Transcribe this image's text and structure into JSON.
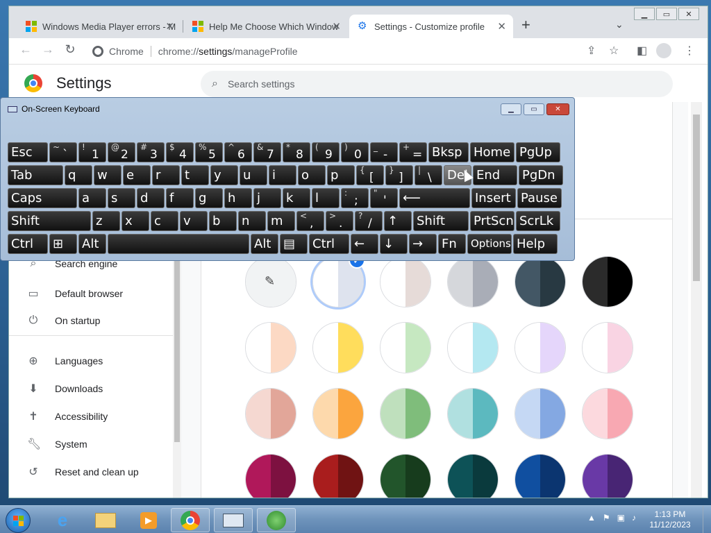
{
  "browser": {
    "tabs": [
      {
        "title": "Windows Media Player errors - M",
        "favicon": "microsoft-logo"
      },
      {
        "title": "Help Me Choose Which Window",
        "favicon": "microsoft-logo"
      },
      {
        "title": "Settings - Customize profile",
        "favicon": "gear-icon"
      }
    ],
    "new_tab": "+",
    "omnibox_site": "Chrome",
    "omnibox_url_prefix": "chrome://",
    "omnibox_url_host": "settings",
    "omnibox_url_path": "/manageProfile"
  },
  "settings": {
    "title": "Settings",
    "search_placeholder": "Search settings",
    "sidebar": [
      {
        "label": "Search engine",
        "icon": "search-icon"
      },
      {
        "label": "Default browser",
        "icon": "browser-icon"
      },
      {
        "label": "On startup",
        "icon": "power-icon"
      },
      {
        "label": "Languages",
        "icon": "globe-icon"
      },
      {
        "label": "Downloads",
        "icon": "download-icon"
      },
      {
        "label": "Accessibility",
        "icon": "accessibility-icon"
      },
      {
        "label": "System",
        "icon": "wrench-icon"
      },
      {
        "label": "Reset and clean up",
        "icon": "reset-icon"
      }
    ],
    "colors": [
      [
        "#f1f3f4",
        "#f1f3f4"
      ],
      [
        "#ffffff",
        "#dee3ee"
      ],
      [
        "#ffffff",
        "#e6dbd8"
      ],
      [
        "#d5d7db",
        "#a9adb7"
      ],
      [
        "#435765",
        "#283942"
      ],
      [
        "#2b2b2b",
        "#000000"
      ],
      [
        "#ffffff",
        "#fcd9c4"
      ],
      [
        "#ffffff",
        "#ffdd5c"
      ],
      [
        "#ffffff",
        "#c6e8c1"
      ],
      [
        "#ffffff",
        "#b4e8f1"
      ],
      [
        "#ffffff",
        "#e5d6fb"
      ],
      [
        "#ffffff",
        "#f9d4e3"
      ],
      [
        "#f5d8d1",
        "#e2a699"
      ],
      [
        "#fdd9ac",
        "#fba53e"
      ],
      [
        "#bfe0bd",
        "#7fbd7b"
      ],
      [
        "#b0e0e0",
        "#5cb9bf"
      ],
      [
        "#c5d8f4",
        "#84a8e2"
      ],
      [
        "#fcd9de",
        "#f8a8b2"
      ],
      [
        "#b0185a",
        "#7d1140"
      ],
      [
        "#a91d1d",
        "#701313"
      ],
      [
        "#22552b",
        "#173c1d"
      ],
      [
        "#0d5257",
        "#0a3a3d"
      ],
      [
        "#104fa0",
        "#0b3570"
      ],
      [
        "#6939a6",
        "#482574"
      ]
    ],
    "selected_color_index": 1
  },
  "keyboard": {
    "title": "On-Screen Keyboard",
    "rows": [
      [
        [
          "Esc",
          ""
        ],
        [
          "~",
          "`"
        ],
        [
          "!",
          "1"
        ],
        [
          "@",
          "2"
        ],
        [
          "#",
          "3"
        ],
        [
          "$",
          "4"
        ],
        [
          "%",
          "5"
        ],
        [
          "^",
          "6"
        ],
        [
          "&",
          "7"
        ],
        [
          "*",
          "8"
        ],
        [
          "(",
          "9"
        ],
        [
          ")",
          "0"
        ],
        [
          "_",
          "-"
        ],
        [
          "+",
          "="
        ],
        [
          "Bksp",
          ""
        ],
        [
          "Home",
          ""
        ],
        [
          "PgUp",
          ""
        ]
      ],
      [
        [
          "Tab",
          ""
        ],
        [
          "q",
          ""
        ],
        [
          "w",
          ""
        ],
        [
          "e",
          ""
        ],
        [
          "r",
          ""
        ],
        [
          "t",
          ""
        ],
        [
          "y",
          ""
        ],
        [
          "u",
          ""
        ],
        [
          "i",
          ""
        ],
        [
          "o",
          ""
        ],
        [
          "p",
          ""
        ],
        [
          "{",
          "["
        ],
        [
          "}",
          "]"
        ],
        [
          "|",
          "\\"
        ],
        [
          "Del",
          ""
        ],
        [
          "End",
          ""
        ],
        [
          "PgDn",
          ""
        ]
      ],
      [
        [
          "Caps",
          ""
        ],
        [
          "a",
          ""
        ],
        [
          "s",
          ""
        ],
        [
          "d",
          ""
        ],
        [
          "f",
          ""
        ],
        [
          "g",
          ""
        ],
        [
          "h",
          ""
        ],
        [
          "j",
          ""
        ],
        [
          "k",
          ""
        ],
        [
          "l",
          ""
        ],
        [
          ":",
          ";"
        ],
        [
          "\"",
          "'"
        ],
        [
          "⟵",
          ""
        ],
        [
          "Insert",
          ""
        ],
        [
          "Pause",
          ""
        ]
      ],
      [
        [
          "Shift",
          ""
        ],
        [
          "z",
          ""
        ],
        [
          "x",
          ""
        ],
        [
          "c",
          ""
        ],
        [
          "v",
          ""
        ],
        [
          "b",
          ""
        ],
        [
          "n",
          ""
        ],
        [
          "m",
          ""
        ],
        [
          "<",
          ","
        ],
        [
          ">",
          "."
        ],
        [
          "?",
          "/"
        ],
        [
          "↑",
          ""
        ],
        [
          "Shift",
          ""
        ],
        [
          "PrtScn",
          ""
        ],
        [
          "ScrLk",
          ""
        ]
      ],
      [
        [
          "Ctrl",
          ""
        ],
        [
          "⊞",
          ""
        ],
        [
          "Alt",
          ""
        ],
        [
          "",
          ""
        ],
        [
          "Alt",
          ""
        ],
        [
          "▤",
          ""
        ],
        [
          "Ctrl",
          ""
        ],
        [
          "←",
          ""
        ],
        [
          "↓",
          ""
        ],
        [
          "→",
          ""
        ],
        [
          "Fn",
          ""
        ],
        [
          "Options",
          ""
        ],
        [
          "Help",
          ""
        ]
      ]
    ],
    "highlighted_key": "Del"
  },
  "taskbar": {
    "time": "1:13 PM",
    "date": "11/12/2023",
    "items": [
      "ie-icon",
      "explorer-icon",
      "media-player-icon",
      "chrome-icon",
      "keyboard-icon",
      "windows-update-icon"
    ]
  }
}
